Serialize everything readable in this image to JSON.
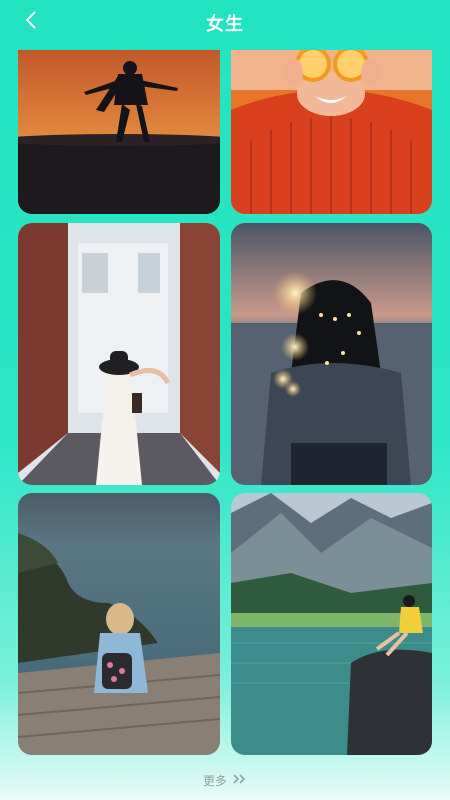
{
  "header": {
    "title": "女生",
    "back_icon": "chevron-left-icon"
  },
  "gallery": {
    "items": [
      {
        "name": "silhouette-sunset-photo"
      },
      {
        "name": "orange-eyes-photo"
      },
      {
        "name": "alley-hat-photo"
      },
      {
        "name": "lights-sea-photo"
      },
      {
        "name": "cliff-coast-photo"
      },
      {
        "name": "mountain-lake-photo"
      }
    ]
  },
  "footer": {
    "more_label": "更多",
    "more_icon": "double-chevron-right-icon"
  },
  "colors": {
    "background": "#22e3c0",
    "header_text": "#ffffff",
    "more_text": "#8fa3a0"
  }
}
